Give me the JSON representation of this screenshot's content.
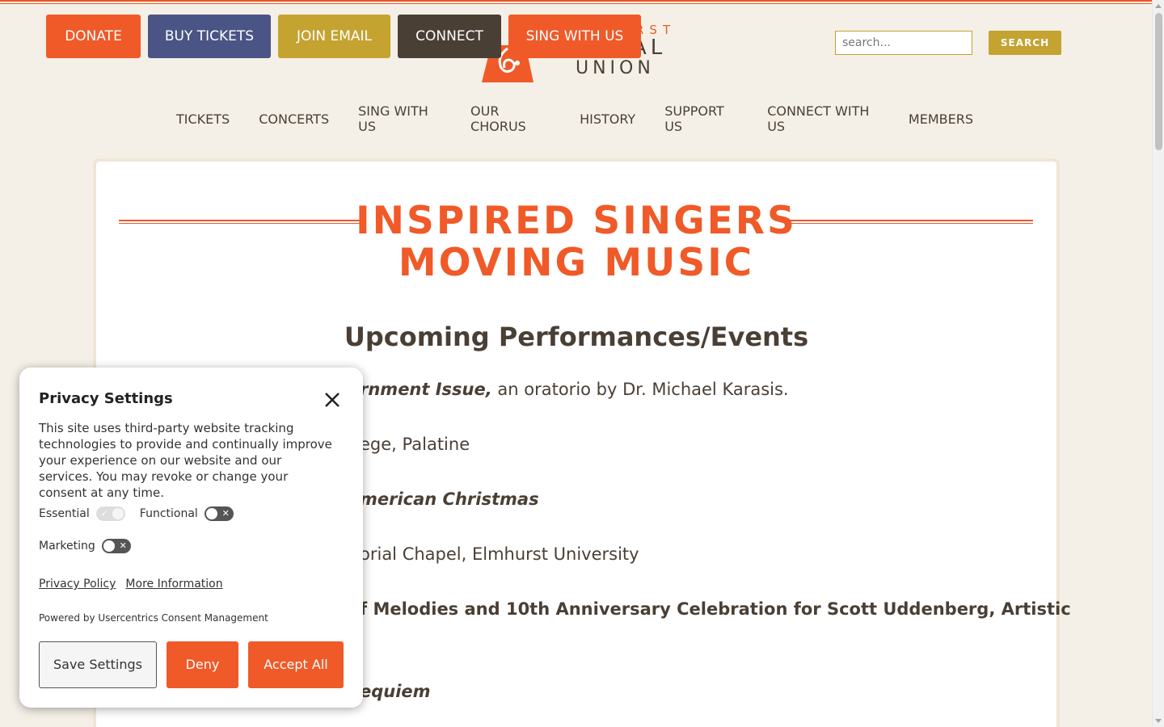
{
  "header": {
    "buttons": {
      "donate": "DONATE",
      "buy_tickets": "BUY TICKETS",
      "join_email": "JOIN EMAIL",
      "connect": "CONNECT",
      "sing_with_us": "SING WITH US"
    },
    "logo": {
      "line1": "RST",
      "line2": "AL",
      "line3": "UNION"
    },
    "search": {
      "placeholder": "search...",
      "button": "SEARCH"
    }
  },
  "nav": {
    "items": [
      "TICKETS",
      "CONCERTS",
      "SING WITH US",
      "OUR CHORUS",
      "HISTORY",
      "SUPPORT US",
      "CONNECT WITH US",
      "MEMBERS"
    ]
  },
  "main": {
    "hero": {
      "line1": "INSPIRED SINGERS",
      "line2": "MOVING MUSIC"
    },
    "section_heading": "Upcoming Performances/Events",
    "events": {
      "e1_title": "rnment Issue,",
      "e1_rest": " an oratorio by Dr. Michael Karasis.",
      "e2": "ege, Palatine",
      "e3": "merican Christmas",
      "e4": "orial Chapel, Elmhurst University",
      "e5": "f Melodies and 10th Anniversary Celebration for Scott Uddenberg, Artistic",
      "e6": "equiem"
    }
  },
  "privacy": {
    "title": "Privacy Settings",
    "text": "This site uses third-party website tracking technologies to provide and continually improve your experience on our website and our services. You may revoke or change your consent at any time.",
    "toggles": {
      "essential": "Essential",
      "functional": "Functional",
      "marketing": "Marketing"
    },
    "links": {
      "policy": "Privacy Policy",
      "more": "More Information"
    },
    "powered": "Powered by Usercentrics Consent Management",
    "buttons": {
      "save": "Save Settings",
      "deny": "Deny",
      "accept": "Accept All"
    }
  },
  "colors": {
    "accent": "#ef5a28",
    "navy": "#4a5585",
    "gold": "#c4a331",
    "dark": "#4a3f35",
    "background": "#f5f0e7"
  }
}
